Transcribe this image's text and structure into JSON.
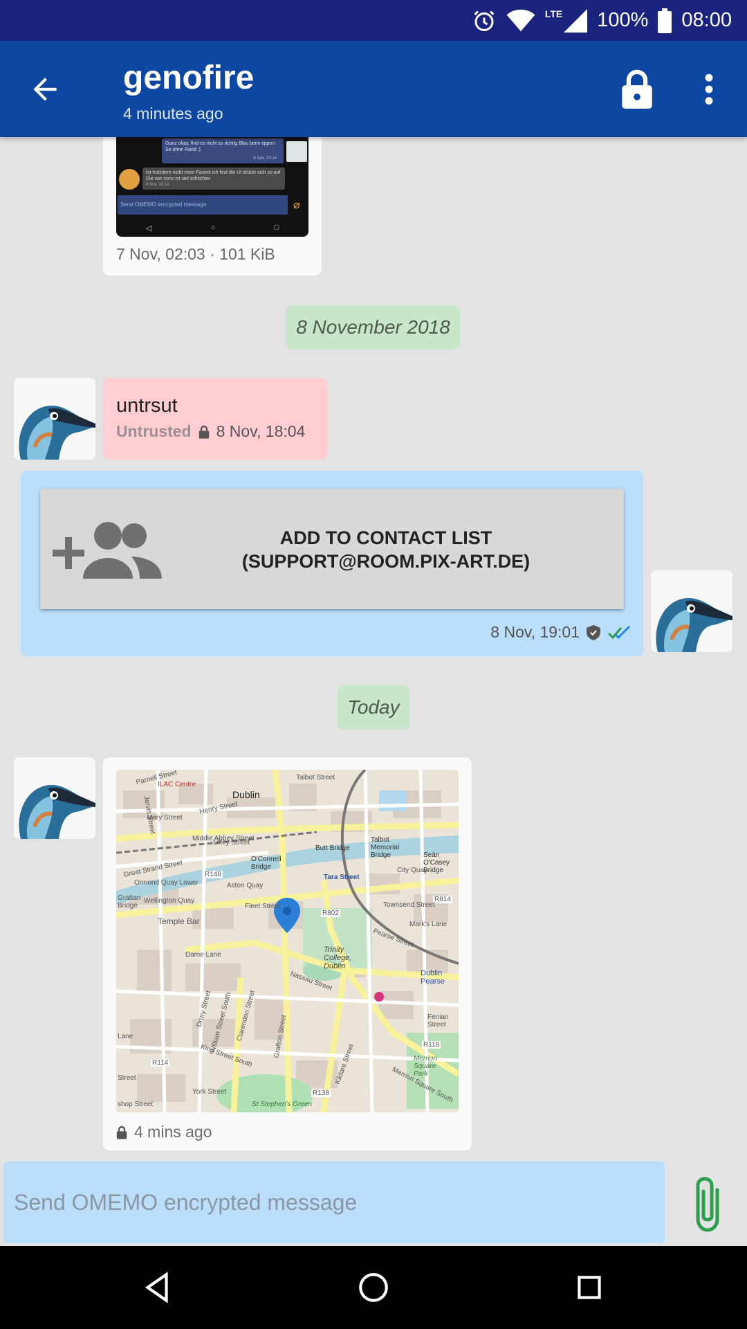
{
  "status_bar": {
    "network_label": "LTE",
    "battery_text": "100%",
    "time": "08:00",
    "icons": [
      "alarm-icon",
      "wifi-icon",
      "cell-signal-icon",
      "battery-icon"
    ]
  },
  "toolbar": {
    "title": "genofire",
    "subtitle": "4 minutes ago",
    "icons": [
      "back-arrow-icon",
      "lock-icon",
      "more-vert-icon"
    ]
  },
  "messages": {
    "screenshot_msg": {
      "meta": "7 Nov, 02:03 · 101 KiB",
      "preview": {
        "line1": "Ganz okay, find es nicht so richtig Blau beim tippen",
        "line2": "So ohne Rand ;)",
        "line1_time": "6 Nov, 20:14",
        "line3": "Ist trotzdem nicht mein Favorit ich find die UI drückt sich so auf",
        "line4": "Die von conv ist viel schlichter",
        "line4_time": "6 Nov, 20:13",
        "input_placeholder": "Send OMEMO encrypted message"
      }
    },
    "date_1": "8 November 2018",
    "untrusted_msg": {
      "text": "untrsut",
      "status": "Untrusted",
      "time": "8 Nov, 18:04"
    },
    "contact_msg": {
      "button_label_line1": "ADD TO CONTACT LIST",
      "button_label_line2": "(SUPPORT@ROOM.PIX-ART.DE)",
      "time": "8 Nov, 19:01",
      "icon": "add-contacts-icon"
    },
    "date_2": "Today",
    "location_msg": {
      "time": "4 mins ago",
      "map_labels": {
        "dublin": "Dublin",
        "ilac": "ILAC Centre",
        "parnell": "Parnell Street",
        "talbot": "Talbot Street",
        "henry": "Henry Street",
        "mary": "Mary Street",
        "abbey": "Middle Abbey Street",
        "butt": "Butt Bridge",
        "memorial": "Talbot Memorial Bridge",
        "oconnell": "O'Connell Bridge",
        "tara": "Tara Street",
        "seancas": "Seán O'Casey Bridge",
        "cityquay": "City Quay",
        "r148": "R148",
        "r814": "R814",
        "r802": "R802",
        "ormond": "Ormond Quay Lower",
        "wellington": "Wellington Quay",
        "aston": "Aston Quay",
        "grattan": "Grattan Bridge",
        "fleet": "Fleet Street",
        "templebar": "Temple Bar",
        "townsend": "Townsend Street",
        "marks": "Mark's Lane",
        "pearse": "Pearse Street",
        "trinity": "Trinity College, Dublin",
        "dublinpearse": "Dublin Pearse",
        "nassau": "Nassau Street",
        "dame": "Dame Lane",
        "fenian": "Fenian Street",
        "r118": "R118",
        "merrion": "Merrion Square Park",
        "merrionsouth": "Merrion Square South",
        "r114": "R114",
        "kingstreet": "King Street South",
        "york": "York Street",
        "r138": "R138",
        "stephens": "St Stephen's Green",
        "kildare": "Kildare Street",
        "grafton": "Grafton Street",
        "drury": "Drury Street",
        "william": "William Street South",
        "clarendon": "Clarendon Street",
        "greatstrand": "Great Strand Street",
        "lane": "Lane",
        "shopstreet": "shop Street",
        "jervis": "Jervis Street",
        "liffey": "Liffey Street",
        "street": "Street"
      }
    }
  },
  "input": {
    "placeholder": "Send OMEMO encrypted message"
  },
  "colors": {
    "status_bar": "#1a237e",
    "toolbar": "#0d47a1",
    "sent_bubble": "#bbdefb",
    "untrusted_bubble": "#ffcdd2",
    "date_pill": "#c8e6c9",
    "attach_icon": "#2e9d4e"
  }
}
